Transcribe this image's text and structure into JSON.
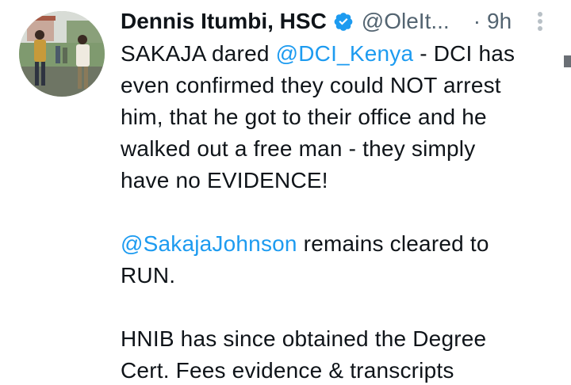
{
  "tweet": {
    "author": {
      "display_name": "Dennis Itumbi, HSC",
      "handle": "@OleIt...",
      "verified": true,
      "avatar_icon": "profile-photo"
    },
    "separator": "·",
    "time": "9h",
    "more_icon": "more-vertical-icon",
    "body": {
      "p1": {
        "l1_text": "SAKAJA dared ",
        "l1_mention": "@DCI_Kenya",
        "l1_rest": " - DCI has",
        "l2": "even confirmed they could NOT arrest",
        "l3": "him, that he got to their office and he",
        "l4": "walked out a free man - they simply",
        "l5": "have no EVIDENCE!"
      },
      "p2": {
        "mention": "@SakajaJohnson",
        "l1_rest": " remains cleared to",
        "l2": "RUN."
      },
      "p3": {
        "l1": "HNIB has since obtained the Degree",
        "l2": "Cert. Fees evidence & transcripts"
      }
    }
  },
  "colors": {
    "text": "#0f1419",
    "secondary": "#536471",
    "link": "#1d9bf0",
    "verified": "#1d9bf0"
  }
}
